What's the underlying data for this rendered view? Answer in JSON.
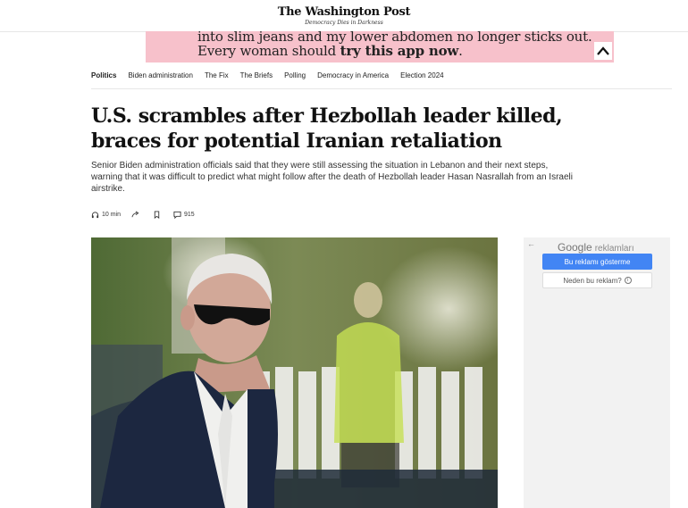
{
  "masthead": {
    "logo": "The Washington Post",
    "tagline": "Democracy Dies in Darkness"
  },
  "ad_banner": {
    "line1": "into slim jeans and my lower abdomen no longer sticks out.",
    "line2_prefix": "Every woman should ",
    "line2_bold": "try this app now",
    "line2_suffix": ".",
    "background_color": "#f7c1cb"
  },
  "nav": {
    "items": [
      "Politics",
      "Biden administration",
      "The Fix",
      "The Briefs",
      "Polling",
      "Democracy in America",
      "Election 2024"
    ]
  },
  "article": {
    "headline_line1": "U.S. scrambles after Hezbollah leader killed,",
    "headline_line2": "braces for potential Iranian retaliation",
    "deck": "Senior Biden administration officials said that they were still assessing the situation in Lebanon and their next steps, warning that it was difficult to predict what might follow after the death of Hezbollah leader Hasan Nasrallah from an Israeli airstrike.",
    "listen_label": "10 min",
    "comments_count": "915",
    "icons": [
      "headphones-icon",
      "share-icon",
      "bookmark-icon",
      "comment-icon"
    ]
  },
  "ad_panel": {
    "back_glyph": "←",
    "google_label": "Google",
    "ads_label": "reklamları",
    "stop_button": "Bu reklamı gösterme",
    "why_button": "Neden bu reklam?",
    "info_glyph": "i",
    "button_color": "#4285f4"
  }
}
